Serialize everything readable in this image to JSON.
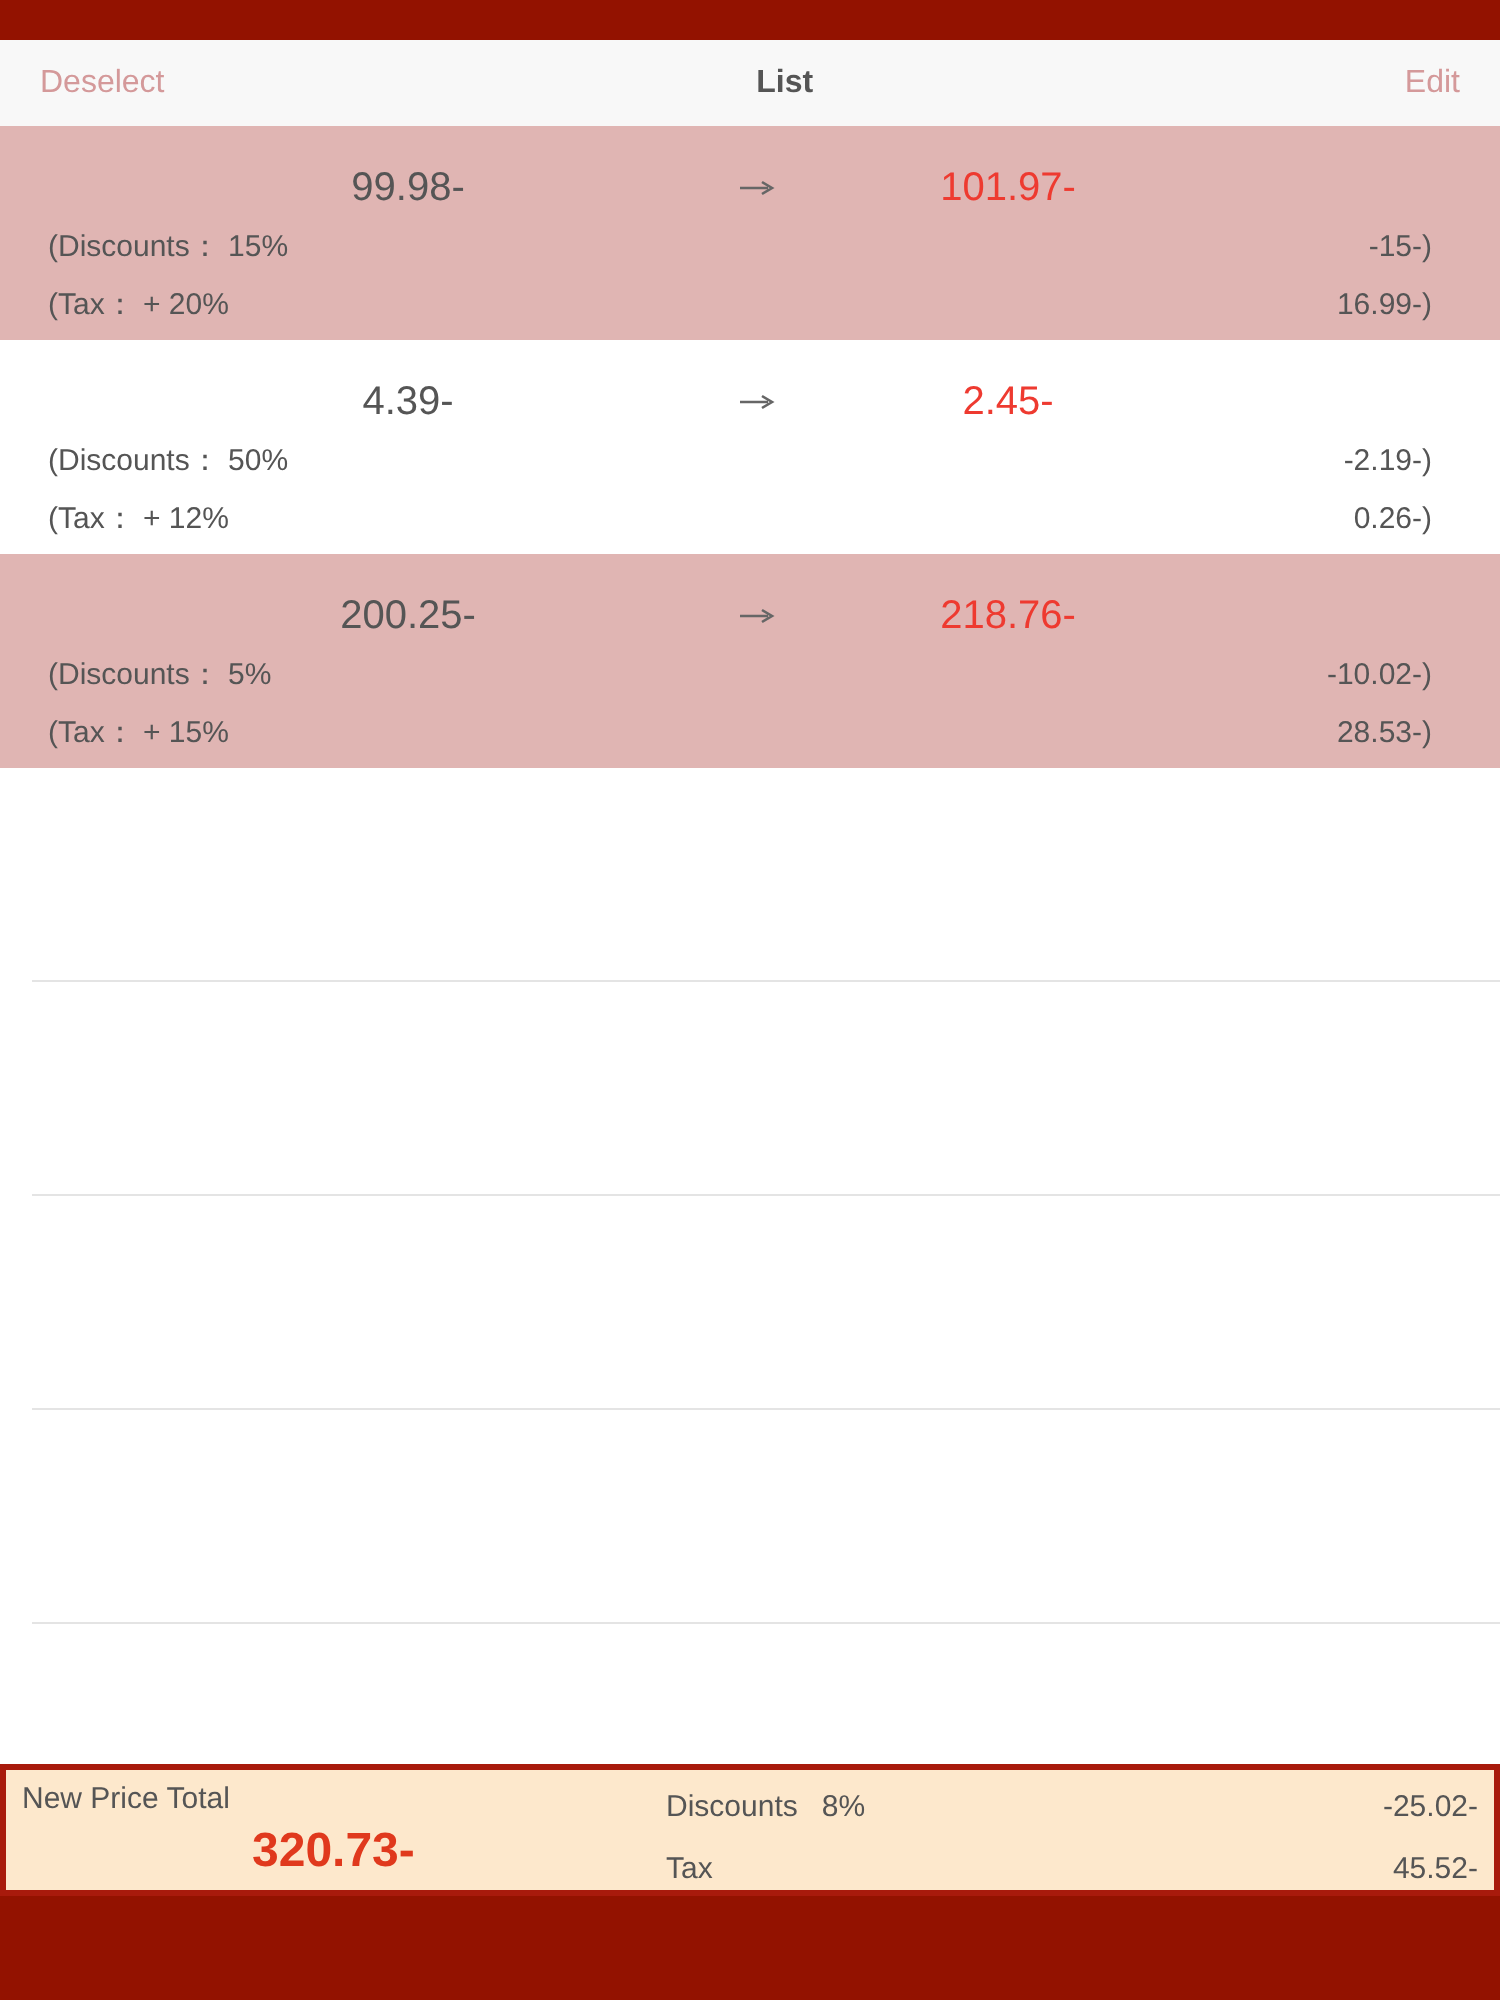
{
  "nav": {
    "left": "Deselect",
    "title": "List",
    "right": "Edit"
  },
  "items": [
    {
      "selected": true,
      "original": "99.98-",
      "new_price": "101.97-",
      "discount_label": "(Discounts： 15%",
      "discount_value": "-15-)",
      "tax_label": "(Tax： + 20%",
      "tax_value": "16.99-)"
    },
    {
      "selected": false,
      "original": "4.39-",
      "new_price": "2.45-",
      "discount_label": "(Discounts： 50%",
      "discount_value": "-2.19-)",
      "tax_label": "(Tax： + 12%",
      "tax_value": "0.26-)"
    },
    {
      "selected": true,
      "original": "200.25-",
      "new_price": "218.76-",
      "discount_label": "(Discounts： 5%",
      "discount_value": "-10.02-)",
      "tax_label": "(Tax： + 15%",
      "tax_value": "28.53-)"
    }
  ],
  "footer": {
    "total_label": "New Price Total",
    "total": "320.73-",
    "discount_label": "Discounts",
    "discount_rate": "8%",
    "discount_value": "-25.02-",
    "tax_label": "Tax",
    "tax_value": "45.52-"
  }
}
